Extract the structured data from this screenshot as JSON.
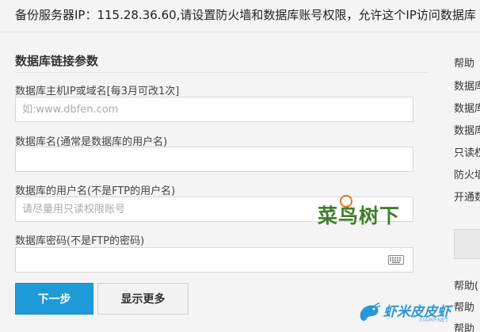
{
  "notice": {
    "text": "备份服务器IP：115.28.36.60,请设置防火墙和数据库账号权限，允许这个IP访问数据库"
  },
  "form": {
    "title": "数据库链接参数",
    "host": {
      "label": "数据库主机IP或域名[每3月可改1次]",
      "value": "",
      "placeholder": "如:www.dbfen.com"
    },
    "dbname": {
      "label": "数据库名(通常是数据库的用户名)",
      "value": "",
      "placeholder": ""
    },
    "username": {
      "label": "数据库的用户名(不是FTP的用户名)",
      "value": "",
      "placeholder": "请尽量用只读权限账号"
    },
    "password": {
      "label": "数据库密码(不是FTP的密码)",
      "value": "",
      "placeholder": ""
    },
    "next_label": "下一步",
    "more_label": "显示更多"
  },
  "sidebar": {
    "items": [
      "帮助",
      "数据库",
      "数据库",
      "数据库",
      "只读权",
      "防火墙",
      "开通数",
      "帮助(",
      "帮助",
      "帮助"
    ]
  },
  "watermarks": {
    "brand1": "菜鸟树下",
    "brand2": "虾米皮皮虾",
    "brand2_sub": "XIAMP.NET"
  }
}
